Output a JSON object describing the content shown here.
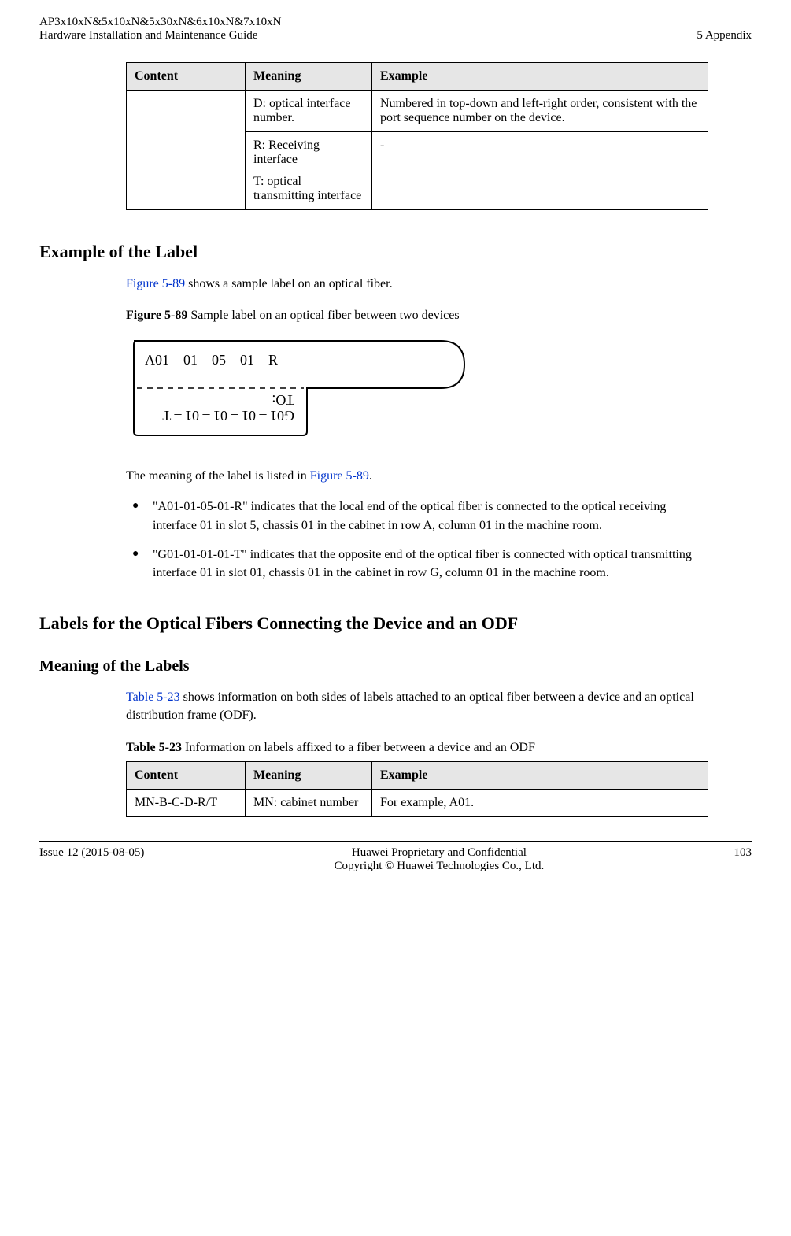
{
  "header": {
    "line1": "AP3x10xN&5x10xN&5x30xN&6x10xN&7x10xN",
    "line2": "Hardware Installation and Maintenance Guide",
    "right": "5 Appendix"
  },
  "top_table": {
    "headers": {
      "content": "Content",
      "meaning": "Meaning",
      "example": "Example"
    },
    "rows": [
      {
        "content": "",
        "meaning": "D: optical interface number.",
        "example": "Numbered in top-down and left-right order, consistent with the port sequence number on the device."
      },
      {
        "content": "",
        "meaning_a": "R: Receiving interface",
        "meaning_b": "T: optical transmitting interface",
        "example": "-"
      }
    ]
  },
  "sections": {
    "example_label_title": "Example of the Label",
    "example_intro_a": "Figure 5-89",
    "example_intro_b": " shows a sample label on an optical fiber.",
    "figure_caption_strong": "Figure 5-89",
    "figure_caption_rest": " Sample label on an optical fiber between two devices",
    "figure_text_front": "A01 – 01  – 05 – 01 –  R",
    "figure_text_back_values": "T  –  10 –  10 –  10  –  10Ɔ",
    "figure_text_back_to": ":OꞱ",
    "meaning_intro_a": "The meaning of the label is listed in ",
    "meaning_intro_link": "Figure 5-89",
    "meaning_intro_b": ".",
    "bullets": [
      "\"A01-01-05-01-R\" indicates that the local end of the optical fiber is connected to the optical receiving interface 01 in slot 5, chassis 01 in the cabinet in row A, column 01 in the machine room.",
      "\"G01-01-01-01-T\" indicates that the opposite end of the optical fiber is connected with optical transmitting interface 01 in slot 01, chassis 01 in the cabinet in row G, column 01 in the machine room."
    ],
    "odf_title": "Labels for the Optical Fibers Connecting the Device and an ODF",
    "meaning_labels_title": "Meaning of the Labels",
    "odf_intro_link": "Table 5-23",
    "odf_intro_rest": " shows information on both sides of labels attached to an optical fiber between a device and an optical distribution frame (ODF).",
    "table23_caption_strong": "Table 5-23",
    "table23_caption_rest": " Information on labels affixed to a fiber between a device and an ODF"
  },
  "bottom_table": {
    "headers": {
      "content": "Content",
      "meaning": "Meaning",
      "example": "Example"
    },
    "rows": [
      {
        "content": "MN-B-C-D-R/T",
        "meaning": "MN: cabinet number",
        "example": "For example, A01."
      }
    ]
  },
  "footer": {
    "left": "Issue 12 (2015-08-05)",
    "center1": "Huawei Proprietary and Confidential",
    "center2": "Copyright © Huawei Technologies Co., Ltd.",
    "right": "103"
  }
}
